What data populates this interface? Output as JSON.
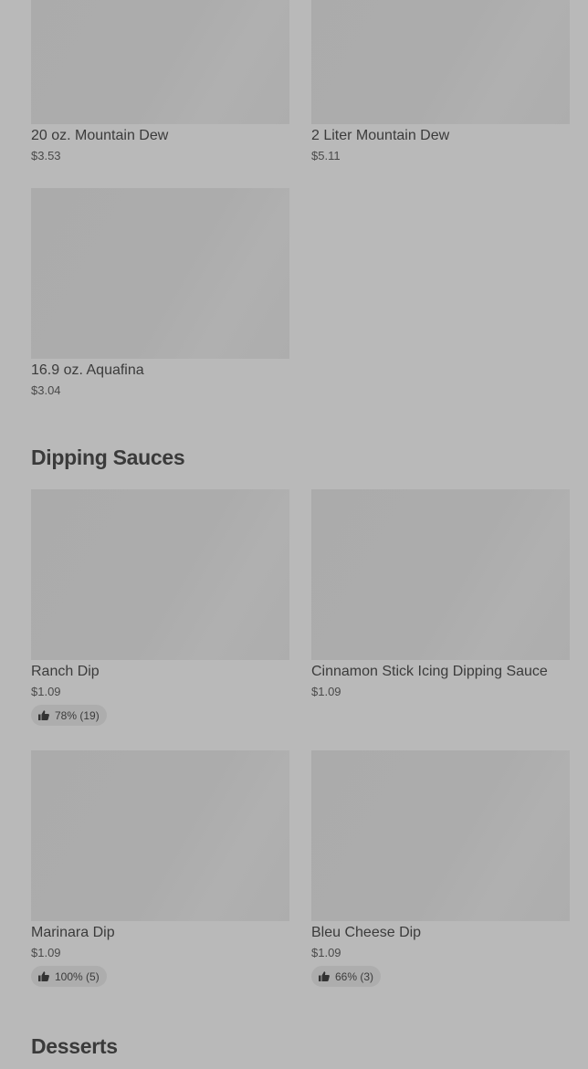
{
  "drinks": {
    "items": [
      {
        "name": "20 oz. Mountain Dew",
        "price": "$3.53"
      },
      {
        "name": "2 Liter Mountain Dew",
        "price": "$5.11"
      },
      {
        "name": "16.9 oz. Aquafina",
        "price": "$3.04"
      }
    ]
  },
  "dipping_sauces": {
    "title": "Dipping Sauces",
    "items": [
      {
        "name": "Ranch Dip",
        "price": "$1.09",
        "rating": "78% (19)"
      },
      {
        "name": "Cinnamon Stick Icing Dipping Sauce",
        "price": "$1.09"
      },
      {
        "name": "Marinara Dip",
        "price": "$1.09",
        "rating": "100% (5)"
      },
      {
        "name": "Bleu Cheese Dip",
        "price": "$1.09",
        "rating": "66% (3)"
      }
    ]
  },
  "desserts": {
    "title": "Desserts"
  },
  "icons": {
    "rating": "thumbs-up-icon"
  },
  "colors": {
    "background": "#b9b9b9",
    "thumbnail": "#acacac",
    "text": "#3a3a3a"
  }
}
